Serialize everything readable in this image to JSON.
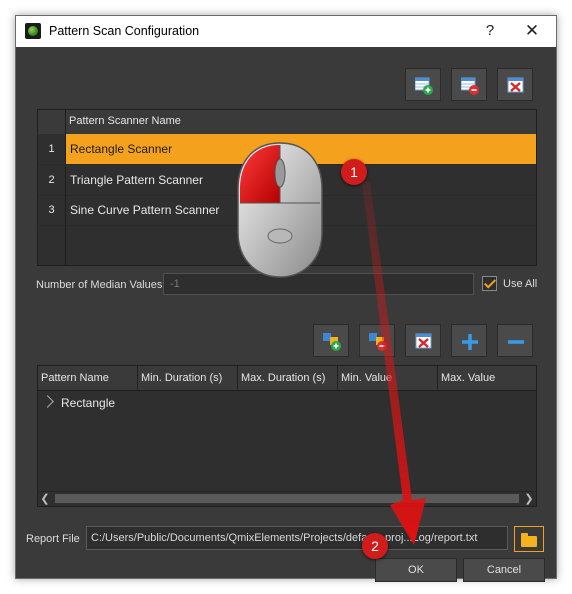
{
  "window": {
    "title": "Pattern Scan Configuration",
    "help_label": "?",
    "close_label": "✕"
  },
  "scanner_grid": {
    "header": "Pattern Scanner Name",
    "rows": [
      {
        "index": "1",
        "name": "Rectangle Scanner",
        "selected": true
      },
      {
        "index": "2",
        "name": "Triangle Pattern Scanner",
        "selected": false
      },
      {
        "index": "3",
        "name": "Sine Curve Pattern Scanner",
        "selected": false
      }
    ]
  },
  "median": {
    "label": "Number of Median Values",
    "placeholder": "-1",
    "use_all_label": "Use All",
    "use_all_checked": true
  },
  "pattern_grid": {
    "columns": [
      "Pattern Name",
      "Min. Duration (s)",
      "Max. Duration (s)",
      "Min. Value",
      "Max. Value"
    ],
    "tree_items": [
      "Rectangle"
    ]
  },
  "report": {
    "label": "Report File",
    "path": "C:/Users/Public/Documents/QmixElements/Projects/default_proj...Log/report.txt"
  },
  "buttons": {
    "ok": "OK",
    "cancel": "Cancel"
  },
  "annotations": {
    "step1": "1",
    "step2": "2"
  },
  "colors": {
    "selection": "#f4a11d",
    "panel_bg": "#3a3a3a",
    "annotation_red": "#d11c1c"
  },
  "icons": {
    "top_toolbar": [
      "add-scanner-icon",
      "remove-scanner-icon",
      "clear-scanners-icon"
    ],
    "pattern_toolbar": [
      "add-pattern-icon",
      "remove-pattern-icon",
      "clear-patterns-icon",
      "plus-icon",
      "minus-icon"
    ]
  }
}
